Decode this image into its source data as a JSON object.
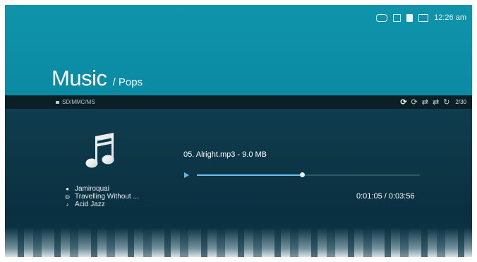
{
  "status": {
    "clock": "12:26 am",
    "icons": [
      "usb-icon",
      "card-icon",
      "storage-icon",
      "battery-icon"
    ]
  },
  "header": {
    "title": "Music",
    "subtitle": "/ Pops"
  },
  "source_bar": {
    "source": "SD/MMC/MS",
    "playlist_position": "2/30",
    "play_modes": [
      "repeat-all-icon",
      "repeat-one-icon",
      "shuffle-icon",
      "shuffle-repeat-icon",
      "repeat-off-icon"
    ],
    "active_mode": "repeat-all-icon"
  },
  "now_playing": {
    "track": "05. Alright.mp3 - 9.0 MB",
    "artist": "Jamiroquai",
    "album": "Travelling Without ...",
    "genre": "Acid Jazz",
    "time": "0:01:05 / 0:03:56",
    "progress": 0.47
  },
  "colors": {
    "header": "#0b8aa3",
    "background": "#0e3b4b",
    "accent": "#67c0ef"
  }
}
